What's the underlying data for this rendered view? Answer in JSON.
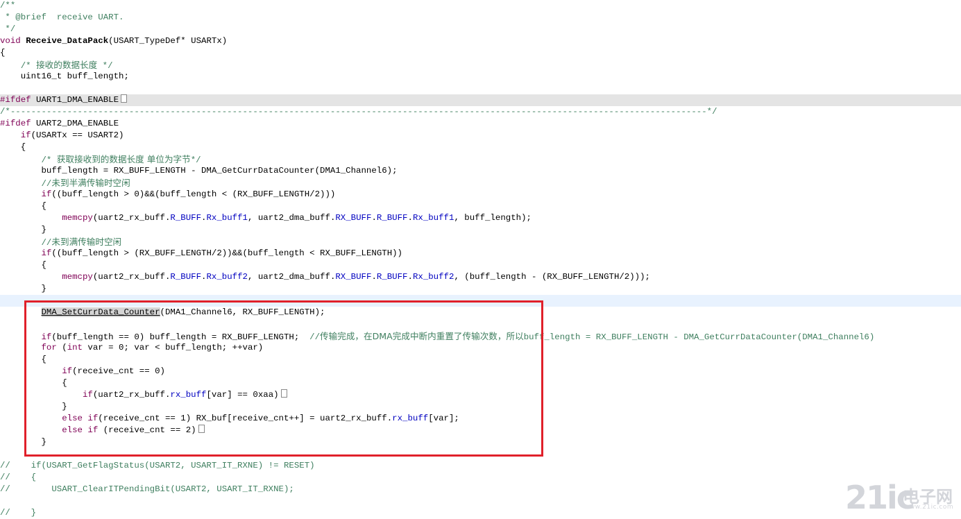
{
  "lines": [
    {
      "hl": "",
      "tokens": [
        {
          "t": "/**",
          "c": "comment"
        }
      ]
    },
    {
      "hl": "",
      "tokens": [
        {
          "t": " * @brief  receive UART.",
          "c": "comment"
        }
      ]
    },
    {
      "hl": "",
      "tokens": [
        {
          "t": " */",
          "c": "comment"
        }
      ]
    },
    {
      "hl": "",
      "tokens": [
        {
          "t": "void",
          "c": "kw"
        },
        {
          "t": " "
        },
        {
          "t": "Receive_DataPack",
          "c": "fn-bold"
        },
        {
          "t": "(USART_TypeDef* USARTx)"
        }
      ]
    },
    {
      "hl": "",
      "tokens": [
        {
          "t": "{"
        }
      ]
    },
    {
      "hl": "",
      "tokens": [
        {
          "t": "    "
        },
        {
          "t": "/* ",
          "c": "comment"
        },
        {
          "t": "接收的数据长度",
          "c": "comment cjk"
        },
        {
          "t": " */",
          "c": "comment"
        }
      ]
    },
    {
      "hl": "",
      "tokens": [
        {
          "t": "    uint16_t buff_length;"
        }
      ]
    },
    {
      "hl": "",
      "tokens": []
    },
    {
      "hl": "gray",
      "tokens": [
        {
          "t": "#ifdef",
          "c": "pre"
        },
        {
          "t": " UART1_DMA_ENABLE"
        }
      ],
      "fold": true
    },
    {
      "hl": "",
      "tokens": [
        {
          "t": "/*---------------------------------------------------------------------------------------------------------------------------------------*/",
          "c": "comment"
        }
      ]
    },
    {
      "hl": "",
      "tokens": [
        {
          "t": "#ifdef",
          "c": "pre"
        },
        {
          "t": " UART2_DMA_ENABLE"
        }
      ]
    },
    {
      "hl": "",
      "tokens": [
        {
          "t": "    "
        },
        {
          "t": "if",
          "c": "kw"
        },
        {
          "t": "(USARTx == USART2)"
        }
      ]
    },
    {
      "hl": "",
      "tokens": [
        {
          "t": "    {"
        }
      ]
    },
    {
      "hl": "",
      "tokens": [
        {
          "t": "        "
        },
        {
          "t": "/* ",
          "c": "comment"
        },
        {
          "t": "获取接收到的数据长度 单位为字节",
          "c": "comment cjk"
        },
        {
          "t": "*/",
          "c": "comment"
        }
      ]
    },
    {
      "hl": "",
      "tokens": [
        {
          "t": "        buff_length = RX_BUFF_LENGTH - DMA_GetCurrDataCounter(DMA1_Channel6);"
        }
      ]
    },
    {
      "hl": "",
      "tokens": [
        {
          "t": "        "
        },
        {
          "t": "//",
          "c": "comment"
        },
        {
          "t": "未到半满传输时空闲",
          "c": "comment cjk"
        }
      ]
    },
    {
      "hl": "",
      "tokens": [
        {
          "t": "        "
        },
        {
          "t": "if",
          "c": "kw"
        },
        {
          "t": "((buff_length > 0)&&(buff_length < (RX_BUFF_LENGTH/2)))"
        }
      ]
    },
    {
      "hl": "",
      "tokens": [
        {
          "t": "        {"
        }
      ]
    },
    {
      "hl": "",
      "tokens": [
        {
          "t": "            "
        },
        {
          "t": "memcpy",
          "c": "kw"
        },
        {
          "t": "(uart2_rx_buff."
        },
        {
          "t": "R_BUFF",
          "c": "field"
        },
        {
          "t": "."
        },
        {
          "t": "Rx_buff1",
          "c": "field"
        },
        {
          "t": ", uart2_dma_buff."
        },
        {
          "t": "RX_BUFF",
          "c": "field"
        },
        {
          "t": "."
        },
        {
          "t": "R_BUFF",
          "c": "field"
        },
        {
          "t": "."
        },
        {
          "t": "Rx_buff1",
          "c": "field"
        },
        {
          "t": ", buff_length);"
        }
      ]
    },
    {
      "hl": "",
      "tokens": [
        {
          "t": "        }"
        }
      ]
    },
    {
      "hl": "",
      "tokens": [
        {
          "t": "        "
        },
        {
          "t": "//",
          "c": "comment"
        },
        {
          "t": "未到满传输时空闲",
          "c": "comment cjk"
        }
      ]
    },
    {
      "hl": "",
      "tokens": [
        {
          "t": "        "
        },
        {
          "t": "if",
          "c": "kw"
        },
        {
          "t": "((buff_length > (RX_BUFF_LENGTH/2))&&(buff_length < RX_BUFF_LENGTH))"
        }
      ]
    },
    {
      "hl": "",
      "tokens": [
        {
          "t": "        {"
        }
      ]
    },
    {
      "hl": "",
      "tokens": [
        {
          "t": "            "
        },
        {
          "t": "memcpy",
          "c": "kw"
        },
        {
          "t": "(uart2_rx_buff."
        },
        {
          "t": "R_BUFF",
          "c": "field"
        },
        {
          "t": "."
        },
        {
          "t": "Rx_buff2",
          "c": "field"
        },
        {
          "t": ", uart2_dma_buff."
        },
        {
          "t": "RX_BUFF",
          "c": "field"
        },
        {
          "t": "."
        },
        {
          "t": "R_BUFF",
          "c": "field"
        },
        {
          "t": "."
        },
        {
          "t": "Rx_buff2",
          "c": "field"
        },
        {
          "t": ", (buff_length - (RX_BUFF_LENGTH/2)));"
        }
      ]
    },
    {
      "hl": "",
      "tokens": [
        {
          "t": "        }"
        }
      ]
    },
    {
      "hl": "blue",
      "tokens": []
    },
    {
      "hl": "",
      "tokens": [
        {
          "t": "        "
        },
        {
          "t": "DMA_SetCurrData_Counter",
          "c": "boxed"
        },
        {
          "t": "(DMA1_Channel6, RX_BUFF_LENGTH);"
        }
      ]
    },
    {
      "hl": "",
      "tokens": []
    },
    {
      "hl": "",
      "tokens": [
        {
          "t": "        "
        },
        {
          "t": "if",
          "c": "kw"
        },
        {
          "t": "(buff_length == 0) buff_length = RX_BUFF_LENGTH;  "
        },
        {
          "t": "//",
          "c": "comment"
        },
        {
          "t": "传输完成，在DMA完成中断内重置了传输次数，所以",
          "c": "comment cjk"
        },
        {
          "t": "buff_length = RX_BUFF_LENGTH - DMA_GetCurrDataCounter(DMA1_Channel6)",
          "c": "comment"
        }
      ]
    },
    {
      "hl": "",
      "tokens": [
        {
          "t": "        "
        },
        {
          "t": "for",
          "c": "kw"
        },
        {
          "t": " ("
        },
        {
          "t": "int",
          "c": "kw"
        },
        {
          "t": " var = 0; var < buff_length; ++var)"
        }
      ]
    },
    {
      "hl": "",
      "tokens": [
        {
          "t": "        {"
        }
      ]
    },
    {
      "hl": "",
      "tokens": [
        {
          "t": "            "
        },
        {
          "t": "if",
          "c": "kw"
        },
        {
          "t": "(receive_cnt == 0)"
        }
      ]
    },
    {
      "hl": "",
      "tokens": [
        {
          "t": "            {"
        }
      ]
    },
    {
      "hl": "",
      "tokens": [
        {
          "t": "                "
        },
        {
          "t": "if",
          "c": "kw"
        },
        {
          "t": "(uart2_rx_buff."
        },
        {
          "t": "rx_buff",
          "c": "field"
        },
        {
          "t": "[var] == 0xaa)"
        }
      ],
      "fold": true
    },
    {
      "hl": "",
      "tokens": [
        {
          "t": "            }"
        }
      ]
    },
    {
      "hl": "",
      "tokens": [
        {
          "t": "            "
        },
        {
          "t": "else",
          "c": "kw"
        },
        {
          "t": " "
        },
        {
          "t": "if",
          "c": "kw"
        },
        {
          "t": "(receive_cnt == 1) RX_buf[receive_cnt++] = uart2_rx_buff."
        },
        {
          "t": "rx_buff",
          "c": "field"
        },
        {
          "t": "[var];"
        }
      ]
    },
    {
      "hl": "",
      "tokens": [
        {
          "t": "            "
        },
        {
          "t": "else",
          "c": "kw"
        },
        {
          "t": " "
        },
        {
          "t": "if",
          "c": "kw"
        },
        {
          "t": " (receive_cnt == 2)"
        }
      ],
      "fold": true
    },
    {
      "hl": "",
      "tokens": [
        {
          "t": "        }"
        }
      ]
    },
    {
      "hl": "",
      "tokens": []
    },
    {
      "hl": "",
      "tokens": [
        {
          "t": "//    if(USART_GetFlagStatus(USART2, USART_IT_RXNE) != RESET)",
          "c": "comment"
        }
      ]
    },
    {
      "hl": "",
      "tokens": [
        {
          "t": "//    {",
          "c": "comment"
        }
      ]
    },
    {
      "hl": "",
      "tokens": [
        {
          "t": "//        USART_ClearITPendingBit(USART2, USART_IT_RXNE);",
          "c": "comment"
        }
      ]
    },
    {
      "hl": "",
      "tokens": []
    },
    {
      "hl": "",
      "tokens": [
        {
          "t": "//    }",
          "c": "comment"
        }
      ]
    }
  ],
  "watermark": {
    "num": "21ic",
    "cn": "电子网",
    "en": "www.21ic.com"
  }
}
